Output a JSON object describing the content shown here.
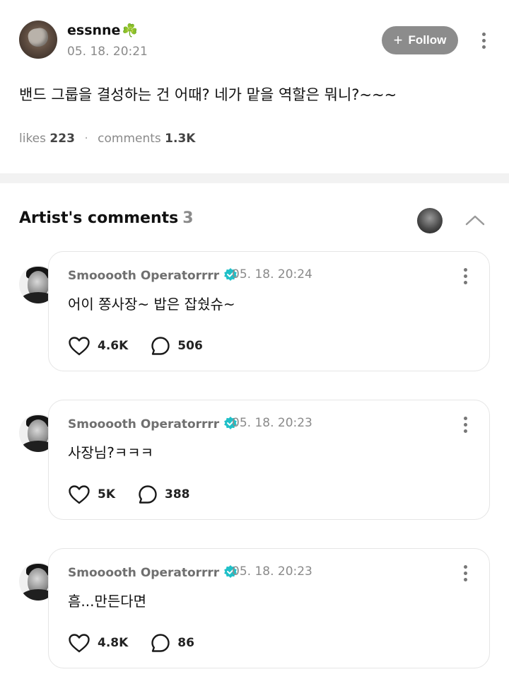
{
  "post": {
    "author": "essnne",
    "author_emoji": "☘️",
    "timestamp": "05. 18. 20:21",
    "follow_label": "Follow",
    "body": "밴드 그룹을 결성하는 건 어때? 네가 맡을 역할은 뭐니?~~~",
    "likes_label": "likes",
    "likes_count": "223",
    "comments_label": "comments",
    "comments_count": "1.3K"
  },
  "artist_comments": {
    "title": "Artist's comments",
    "count": "3"
  },
  "comments": [
    {
      "author": "Smooooth Operatorrrr",
      "timestamp": "05. 18. 20:24",
      "text": "어이 쫑사장~ 밥은 잡쉈슈~",
      "likes": "4.6K",
      "replies": "506"
    },
    {
      "author": "Smooooth Operatorrrr",
      "timestamp": "05. 18. 20:23",
      "text": "사장님?ㅋㅋㅋ",
      "likes": "5K",
      "replies": "388"
    },
    {
      "author": "Smooooth Operatorrrr",
      "timestamp": "05. 18. 20:23",
      "text": "흠...만든다면",
      "likes": "4.8K",
      "replies": "86"
    }
  ],
  "colors": {
    "follow_button": "#8c8c8c",
    "verified_badge": "#1fc0c8",
    "muted_text": "#8a8a8a"
  },
  "icons": [
    "heart-icon",
    "comment-bubble-icon",
    "verified-badge-icon",
    "more-vertical-icon",
    "chevron-up-icon",
    "plus-icon",
    "clover-emoji"
  ]
}
